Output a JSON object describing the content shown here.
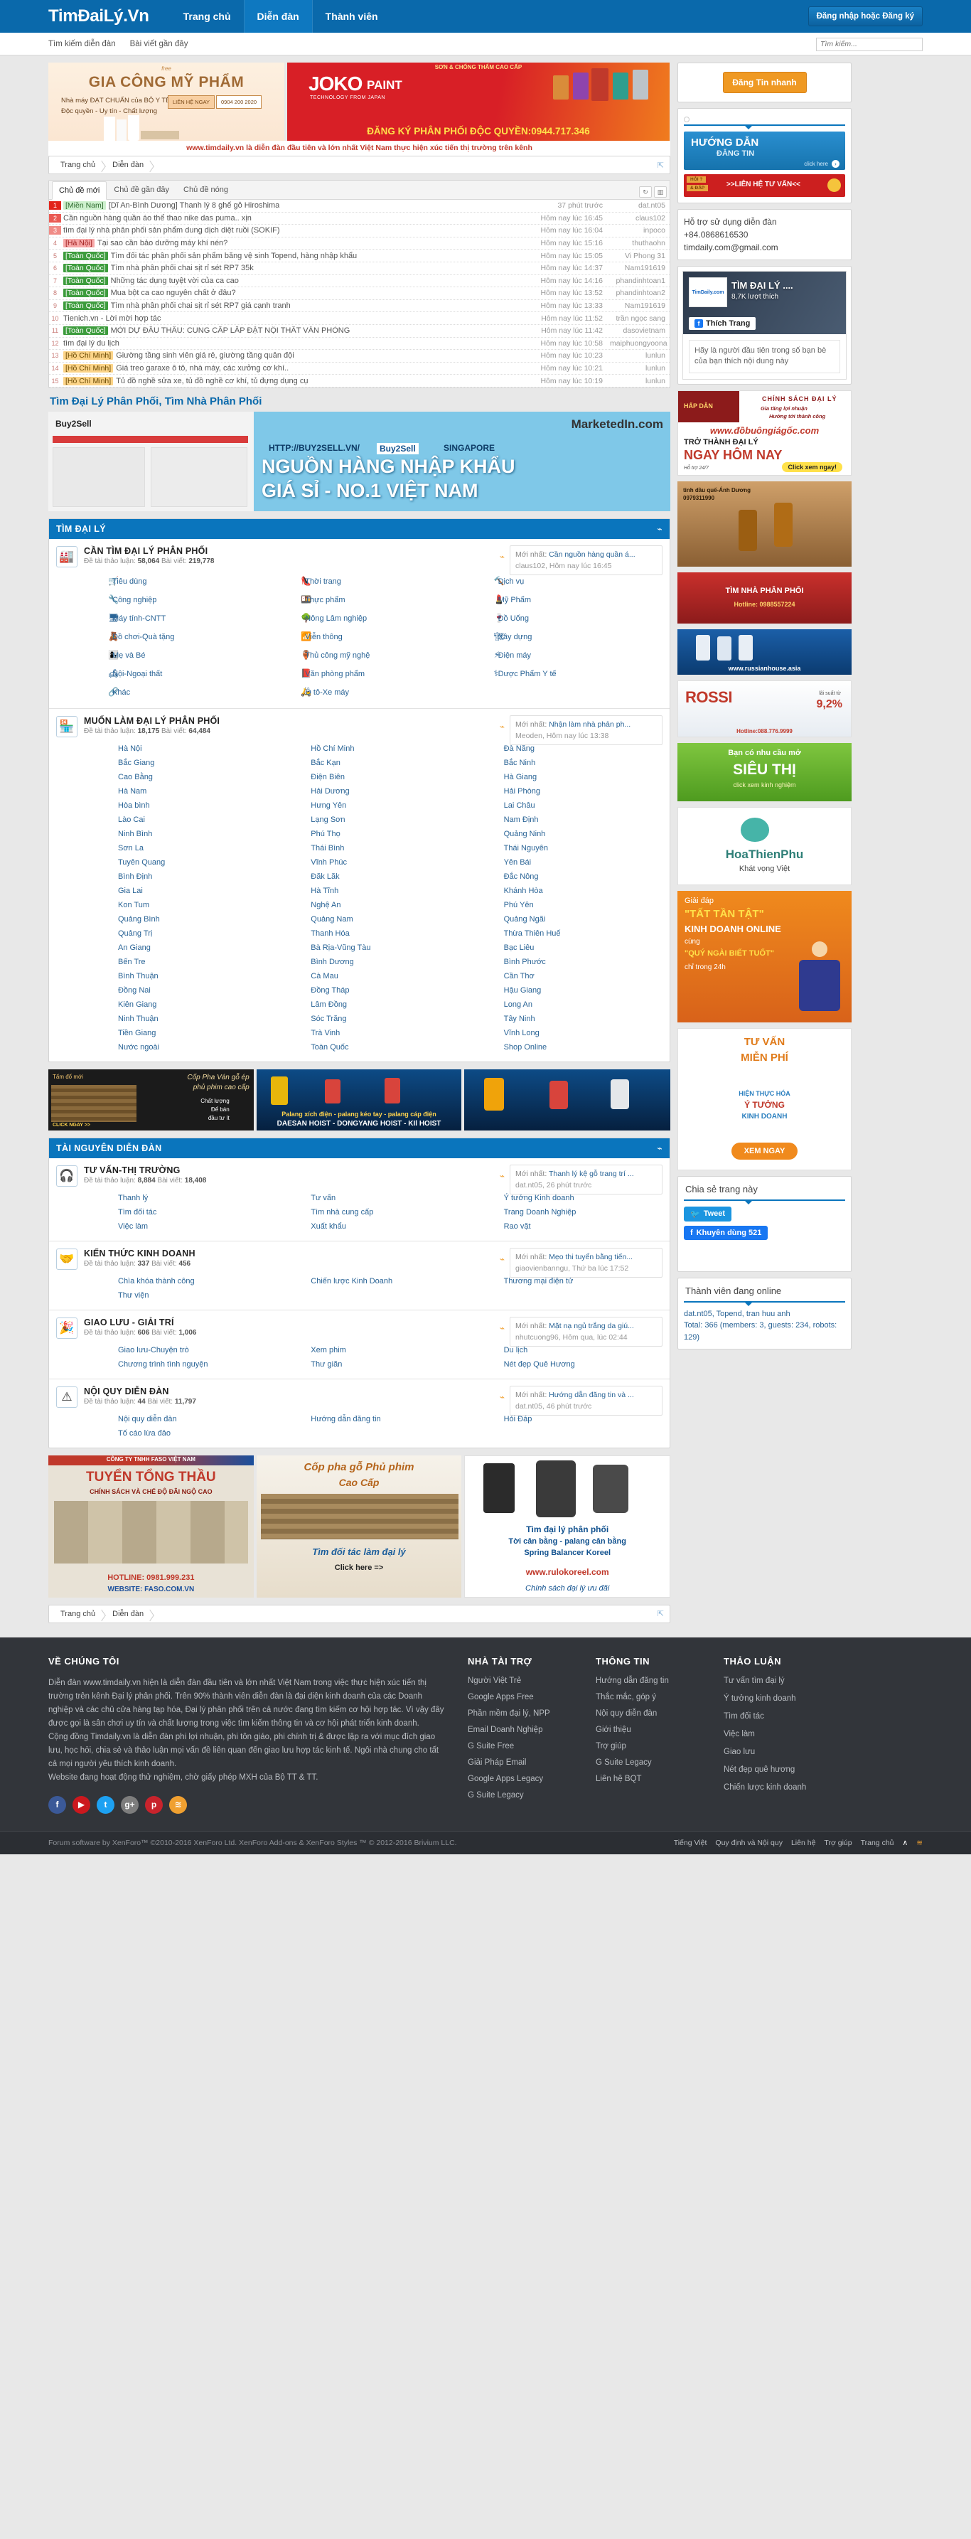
{
  "header": {
    "logo": "TimĐaiLý.Vn",
    "nav": [
      {
        "label": "Trang chủ",
        "selected": false
      },
      {
        "label": "Diễn đàn",
        "selected": true
      },
      {
        "label": "Thành viên",
        "selected": false
      }
    ],
    "login_label": "Đăng nhập hoặc Đăng ký",
    "subnav": [
      "Tìm kiếm diễn đàn",
      "Bài viết gần đây"
    ],
    "search_placeholder": "Tìm kiếm...",
    "search_value": ""
  },
  "ads": {
    "banner_left": {
      "line1": "free",
      "title": "GIA CÔNG MỸ PHẨM",
      "sub1": "Nhà máy ĐẠT CHUẨN của BỘ Y TẾ",
      "sub2": "Độc quyền - Uy tín - Chất lượng",
      "btn": "LIÊN HỆ NGAY",
      "phone": "0904 200 2020"
    },
    "banner_right": {
      "top": "SƠN & CHỐNG THẤM CAO CẤP",
      "brand": "JOKO",
      "brand2": "PAINT",
      "tech": "TECHNOLOGY FROM JAPAN",
      "bottom": "ĐĂNG KÝ PHÂN PHỐI ĐỘC QUYỀN:0944.717.346"
    },
    "tagline": "www.timdaily.vn là diễn đàn đầu tiên và lớn nhất Việt Nam thực hiện xúc tiến thị trường trên kênh",
    "mid_banner": {
      "url": "HTTP://BUY2SELL.VN/",
      "brand": "Buy2Sell",
      "city": "SINGAPORE",
      "l1": "NGUỒN HÀNG NHẬP KHẨU",
      "l2": "GIÁ SỈ - NO.1 VIỆT NAM",
      "left_logo": "Buy2Sell",
      "right_logo": "MarketedIn.com"
    },
    "hoist": {
      "l1": "Tấm đổ mới",
      "l2": "Cốp Pha Ván gỗ ép",
      "l3": "phủ phim cao cấp",
      "l4": "Chất lượng",
      "l5": "Để bán",
      "l6": "đầu tư ít",
      "click": "CLICK NGAY >>",
      "mid1": "Palang xích điện - palang kéo tay - palang cáp điện",
      "mid2": "DAESAN HOIST - DONGYANG HOIST - KIl HOIST"
    },
    "faso": {
      "co": "CÔNG TY TNHH FASO VIỆT NAM",
      "t1": "TUYỂN TỔNG THẦU",
      "t2": "CHÍNH SÁCH VÀ CHẾ ĐỘ ĐÃI NGỘ CAO",
      "hot": "HOTLINE: 0981.999.231",
      "web": "WEBSITE: FASO.COM.VN"
    },
    "copha": {
      "t1": "Cốp pha gỗ Phủ phim",
      "t2": "Cao Cấp",
      "t3": "Tìm đối tác làm đại lý",
      "t4": "Click here =>"
    },
    "koreel": {
      "t1": "Tìm đại lý phân phối",
      "t2": "Tời cân bằng - palang cân bằng",
      "t3": "Spring Balancer Koreel",
      "t4": "www.rulokoreel.com",
      "t5": "Chính sách đại lý ưu đãi"
    }
  },
  "breadcrumb": [
    "Trang chủ",
    "Diễn đàn"
  ],
  "ticker": {
    "tabs": [
      {
        "label": "Chủ đề mới",
        "active": true
      },
      {
        "label": "Chủ đề gần đây",
        "active": false
      },
      {
        "label": "Chủ đề nóng",
        "active": false
      }
    ],
    "tool_refresh": "↻",
    "tool_layout": "▥",
    "rows": [
      {
        "n": "1",
        "heat": "h1",
        "loc": "[Miền Nam]",
        "loc_style": "green",
        "title": "[Dĩ An-Bình Dương] Thanh lý 8 ghế gỗ Hiroshima",
        "time": "37 phút trước",
        "user": "dat.nt05"
      },
      {
        "n": "2",
        "heat": "h2",
        "loc": "",
        "loc_style": "",
        "title": "Cần nguồn hàng quần áo thể thao nike das puma.. xịn",
        "time": "Hôm nay lúc 16:45",
        "user": "claus102"
      },
      {
        "n": "3",
        "heat": "h3",
        "loc": "",
        "loc_style": "",
        "title": "tìm đại lý nhà phân phối sản phẩm dung dịch diệt ruồi (SOKIF)",
        "time": "Hôm nay lúc 16:04",
        "user": "inpoco"
      },
      {
        "n": "4",
        "heat": "plain",
        "loc": "[Hà Nội]",
        "loc_style": "red",
        "title": "Tại sao cần bảo dưỡng máy khí nén?",
        "time": "Hôm nay lúc 15:16",
        "user": "thuthaohn"
      },
      {
        "n": "5",
        "heat": "plain",
        "loc": "[Toàn Quốc]",
        "loc_style": "greend",
        "title": "Tìm đối tác phân phối sản phẩm băng vệ sinh Topend, hàng nhập khẩu",
        "time": "Hôm nay lúc 15:05",
        "user": "Vi Phong 31"
      },
      {
        "n": "6",
        "heat": "plain",
        "loc": "[Toàn Quốc]",
        "loc_style": "greend",
        "title": "Tìm nhà phân phối chai sịt rỉ sét RP7 35k",
        "time": "Hôm nay lúc 14:37",
        "user": "Nam191619"
      },
      {
        "n": "7",
        "heat": "plain",
        "loc": "[Toàn Quốc]",
        "loc_style": "greend",
        "title": "Những tác dụng tuyệt vời của ca cao",
        "time": "Hôm nay lúc 14:16",
        "user": "phandinhtoan1"
      },
      {
        "n": "8",
        "heat": "plain",
        "loc": "[Toàn Quốc]",
        "loc_style": "greend",
        "title": "Mua bột ca cao nguyên chất ở đâu?",
        "time": "Hôm nay lúc 13:52",
        "user": "phandinhtoan2"
      },
      {
        "n": "9",
        "heat": "plain",
        "loc": "[Toàn Quốc]",
        "loc_style": "greend",
        "title": "Tìm nhà phân phối chai sịt rỉ sét RP7 giá cạnh tranh",
        "time": "Hôm nay lúc 13:33",
        "user": "Nam191619"
      },
      {
        "n": "10",
        "heat": "plain",
        "loc": "",
        "loc_style": "",
        "title": "Tienich.vn - Lời mời hợp tác",
        "time": "Hôm nay lúc 11:52",
        "user": "trần ngọc sang"
      },
      {
        "n": "11",
        "heat": "plain",
        "loc": "[Toàn Quốc]",
        "loc_style": "greend",
        "title": "MỜI DỰ ĐẤU THẦU: CUNG CẤP LẮP ĐẶT NỘI THẤT VĂN PHÒNG",
        "time": "Hôm nay lúc 11:42",
        "user": "dasovietnam"
      },
      {
        "n": "12",
        "heat": "plain",
        "loc": "",
        "loc_style": "",
        "title": "tìm đại lý du lịch",
        "time": "Hôm nay lúc 10:58",
        "user": "maiphuongyoona"
      },
      {
        "n": "13",
        "heat": "plain",
        "loc": "[Hồ Chí Minh]",
        "loc_style": "orange",
        "title": "Giường tầng sinh viên giá rẻ, giường tầng quân đội",
        "time": "Hôm nay lúc 10:23",
        "user": "lunlun"
      },
      {
        "n": "14",
        "heat": "plain",
        "loc": "[Hồ Chí Minh]",
        "loc_style": "orange",
        "title": "Giá treo garaxe ô tô, nhà máy, các xưởng cơ khí..",
        "time": "Hôm nay lúc 10:21",
        "user": "lunlun"
      },
      {
        "n": "15",
        "heat": "plain",
        "loc": "[Hồ Chí Minh]",
        "loc_style": "orange",
        "title": "Tủ đồ nghề sửa xe, tủ đồ nghề cơ khí, tủ đựng dụng cụ",
        "time": "Hôm nay lúc 10:19",
        "user": "lunlun"
      }
    ]
  },
  "section_heading": "Tìm Đại Lý Phân Phối, Tìm Nhà Phân Phối",
  "forum_a": {
    "title": "TÌM ĐẠI LÝ",
    "nodes": [
      {
        "icon": "🏭",
        "name": "CẦN TÌM ĐẠI LÝ PHÂN PHỐI",
        "stats_label1": "Đề tài thảo luận:",
        "stats_v1": "58,064",
        "stats_label2": "Bài viết:",
        "stats_v2": "219,778",
        "latest_prefix": "Mới nhất:",
        "latest_title": "Cần nguồn hàng quần á...",
        "latest_meta": "claus102, Hôm nay lúc 16:45",
        "cols": [
          [
            {
              "ic": "🛒",
              "t": "Tiêu dùng"
            },
            {
              "ic": "🔧",
              "t": "Công nghiệp"
            },
            {
              "ic": "🖥",
              "t": "Máy tính-CNTT"
            },
            {
              "ic": "🧸",
              "t": "Đồ chơi-Quà tặng"
            },
            {
              "ic": "👩‍👦",
              "t": "Mẹ và Bé"
            },
            {
              "ic": "🛋",
              "t": "Nội-Ngoại thất"
            },
            {
              "ic": "🔗",
              "t": "Khác"
            }
          ],
          [
            {
              "ic": "👠",
              "t": "Thời trang"
            },
            {
              "ic": "🍱",
              "t": "Thực phẩm"
            },
            {
              "ic": "🌳",
              "t": "Nông Lâm nghiệp"
            },
            {
              "ic": "📶",
              "t": "Viễn thông"
            },
            {
              "ic": "🏺",
              "t": "Thủ công mỹ nghệ"
            },
            {
              "ic": "📕",
              "t": "Văn phòng phẩm"
            },
            {
              "ic": "🛵",
              "t": "Ô tô-Xe máy"
            }
          ],
          [
            {
              "ic": "🔨",
              "t": "Dịch vụ"
            },
            {
              "ic": "💄",
              "t": "Mỹ Phẩm"
            },
            {
              "ic": "🍷",
              "t": "Đồ Uống"
            },
            {
              "ic": "🏗",
              "t": "Xây dựng"
            },
            {
              "ic": "⚡",
              "t": "Điện máy"
            },
            {
              "ic": "⚕",
              "t": "Dược Phẩm Y tế"
            }
          ]
        ]
      },
      {
        "icon": "🏪",
        "name": "MUỐN LÀM ĐẠI LÝ PHÂN PHỐI",
        "stats_label1": "Đề tài thảo luận:",
        "stats_v1": "18,175",
        "stats_label2": "Bài viết:",
        "stats_v2": "64,484",
        "latest_prefix": "Mới nhất:",
        "latest_title": "Nhận làm nhà phân ph...",
        "latest_meta": "Meoden, Hôm nay lúc 13:38",
        "plain_cols": [
          [
            "Hà Nội",
            "Bắc Giang",
            "Cao Bằng",
            "Hà Nam",
            "Hòa bình",
            "Lào Cai",
            "Ninh Bình",
            "Sơn La",
            "Tuyên Quang",
            "Bình Định",
            "Gia Lai",
            "Kon Tum",
            "Quảng Bình",
            "Quảng Trị",
            "An Giang",
            "Bến Tre",
            "Bình Thuận",
            "Đồng Nai",
            "Kiên Giang",
            "Ninh Thuận",
            "Tiền Giang",
            "Nước ngoài"
          ],
          [
            "Hồ Chí Minh",
            "Bắc Kạn",
            "Điện Biên",
            "Hải Dương",
            "Hưng Yên",
            "Lạng Sơn",
            "Phú Thọ",
            "Thái Bình",
            "Vĩnh Phúc",
            "Đăk Lăk",
            "Hà Tĩnh",
            "Nghệ An",
            "Quảng Nam",
            "Thanh Hóa",
            "Bà Rịa-Vũng Tàu",
            "Bình Dương",
            "Cà Mau",
            "Đồng Tháp",
            "Lâm Đồng",
            "Sóc Trăng",
            "Trà Vinh",
            "Toàn Quốc"
          ],
          [
            "Đà Nẵng",
            "Bắc Ninh",
            "Hà Giang",
            "Hải Phòng",
            "Lai Châu",
            "Nam Định",
            "Quảng Ninh",
            "Thái Nguyên",
            "Yên Bái",
            "Đắc Nông",
            "Khánh Hòa",
            "Phú Yên",
            "Quảng Ngãi",
            "Thừa Thiên Huế",
            "Bạc Liêu",
            "Bình Phước",
            "Cần Thơ",
            "Hậu Giang",
            "Long An",
            "Tây Ninh",
            "Vĩnh Long",
            "Shop Online"
          ]
        ]
      }
    ]
  },
  "forum_b": {
    "title": "TÀI NGUYÊN DIỄN ĐÀN",
    "nodes": [
      {
        "icon": "🎧",
        "name": "TƯ VẤN-THỊ TRƯỜNG",
        "stats_label1": "Đề tài thảo luận:",
        "stats_v1": "8,884",
        "stats_label2": "Bài viết:",
        "stats_v2": "18,408",
        "latest_prefix": "Mới nhất:",
        "latest_title": "Thanh lý kệ gỗ trang trí ...",
        "latest_meta": "dat.nt05, 26 phút trước",
        "plain_cols": [
          [
            "Thanh lý",
            "Tìm đối tác",
            "Việc làm"
          ],
          [
            "Tư vấn",
            "Tìm nhà cung cấp",
            "Xuất khẩu"
          ],
          [
            "Ý tưởng Kinh doanh",
            "Trang Doanh Nghiệp",
            "Rao vặt"
          ]
        ]
      },
      {
        "icon": "🤝",
        "name": "KIẾN THỨC KINH DOANH",
        "stats_label1": "Đề tài thảo luận:",
        "stats_v1": "337",
        "stats_label2": "Bài viết:",
        "stats_v2": "456",
        "latest_prefix": "Mới nhất:",
        "latest_title": "Mẹo thi tuyển bằng tiến...",
        "latest_meta": "giaovienbanngu, Thứ ba lúc 17:52",
        "plain_cols": [
          [
            "Chìa khóa thành công",
            "Thư viện"
          ],
          [
            "Chiến lược Kinh Doanh"
          ],
          [
            "Thương mại điện tử"
          ]
        ]
      },
      {
        "icon": "🎉",
        "name": "GIAO LƯU - GIẢI TRÍ",
        "stats_label1": "Đề tài thảo luận:",
        "stats_v1": "606",
        "stats_label2": "Bài viết:",
        "stats_v2": "1,006",
        "latest_prefix": "Mới nhất:",
        "latest_title": "Mặt nạ ngủ trắng da giú...",
        "latest_meta": "nhutcuong96, Hôm qua, lúc 02:44",
        "plain_cols": [
          [
            "Giao lưu-Chuyện trò",
            "Chương trình tình nguyện"
          ],
          [
            "Xem phim",
            "Thư giãn"
          ],
          [
            "Du lịch",
            "Nét đẹp Quê Hương"
          ]
        ]
      },
      {
        "icon": "⚠",
        "name": "NỘI QUY DIỄN ĐÀN",
        "stats_label1": "Đề tài thảo luận:",
        "stats_v1": "44",
        "stats_label2": "Bài viết:",
        "stats_v2": "11,797",
        "latest_prefix": "Mới nhất:",
        "latest_title": "Hướng dẫn đăng tin và ...",
        "latest_meta": "dat.nt05, 46 phút trước",
        "plain_cols": [
          [
            "Nội quy diễn đàn",
            "Tố cáo lừa đảo"
          ],
          [
            "Hướng dẫn đăng tin"
          ],
          [
            "Hỏi Đáp"
          ]
        ]
      }
    ]
  },
  "sidebar": {
    "post_button": "Đăng Tin nhanh",
    "guide_banner": {
      "l1": "HƯỚNG DẪN",
      "l2": "ĐĂNG TIN",
      "l3": "click here"
    },
    "contact_banner": {
      "l1": "HỎI ?",
      "l2": "& ĐÁP",
      "l3": ">>LIÊN HỆ TƯ VẤN<<"
    },
    "support": {
      "l1": "Hỗ trợ sử dụng diễn đàn",
      "l2": "+84.0868616530",
      "l3": "timdaily.com@gmail.com"
    },
    "facebook": {
      "logo_text": "TimDaily.com",
      "page": "TÌM ĐẠI LÝ ....",
      "likes": "8,7K lượt thích",
      "like_btn": "Thích Trang",
      "note": "Hãy là người đầu tiên trong số bạn bè của bạn thích nội dung này"
    },
    "ad_dobuon": {
      "tag": "HẤP DẪN",
      "policy": "CHÍNH SÁCH ĐẠI LÝ",
      "p1": "Gia tăng lợi nhuận",
      "p2": "Hướng tới thành công",
      "url": "www.đồbuôngiágốc.com",
      "t1": "TRỞ THÀNH ĐẠI LÝ",
      "t2": "NGAY HÔM NAY",
      "t3": "Hỗ trợ 24/7",
      "cta": "Click xem ngay!"
    },
    "ad_tinhdau": {
      "l1": "tinh dầu quế-Ánh Dương",
      "l2": "0979311990"
    },
    "ad_nhapkhau": {
      "l1": "TÌM NHÀ PHÂN PHỐI",
      "l2": "Hotline: 0988557224"
    },
    "ad_russian": {
      "l1": "www.russianhouse.asia"
    },
    "ad_rossi": {
      "brand": "ROSSI",
      "pct": "9,2%",
      "l1": "lãi suất từ",
      "hot": "Hotline:088.776.9999"
    },
    "ad_sieuthi": {
      "l1": "Bạn có nhu cầu mở",
      "l2": "SIÊU THỊ",
      "l3": "click xem kinh nghiệm"
    },
    "ad_hoathienphu": {
      "l1": "HoaThienPhu",
      "l2": "Khát vọng Việt"
    },
    "ad_tattantat": {
      "l1": "Giải đáp",
      "l2": "\"TẤT TẦN TẬT\"",
      "l3": "KINH DOANH ONLINE",
      "l4": "cùng",
      "l5": "\"QUÝ NGÀI BIẾT TUỐT\"",
      "l6": "chỉ trong 24h"
    },
    "ad_tuvan": {
      "l1": "TƯ VẤN",
      "l2": "MIỄN PHÍ",
      "l3": "HIỆN THỰC HÓA",
      "l4": "Ý TƯỞNG",
      "l5": "KINH DOANH",
      "cta": "XEM NGAY"
    },
    "share": {
      "title": "Chia sẻ trang này",
      "tweet": "Tweet",
      "fb": "Khuyên dùng 521"
    },
    "online": {
      "title": "Thành viên đang online",
      "users": "dat.nt05, Topend, tran huu anh",
      "total": "Total: 366 (members: 3, guests: 234, robots: 129)"
    }
  },
  "footer": {
    "about_title": "VỀ CHÚNG TÔI",
    "about_p1": "Diễn đàn www.timdaily.vn hiện là diễn đàn đầu tiên và lớn nhất Việt Nam trong việc thực hiện xúc tiến thị trường trên kênh Đại lý phân phối. Trên 90% thành viên diễn đàn là đại diện kinh doanh của các Doanh nghiệp và các chủ cửa hàng tạp hóa, Đại lý phân phối trên cả nước đang tìm kiếm cơ hội hợp tác. Vì vậy đây được gọi là sân chơi uy tín và chất lượng trong việc tìm kiếm thông tin và cơ hội phát triển kinh doanh.",
    "about_p2": "Cộng đồng Timdaily.vn là diễn đàn phi lợi nhuận, phi tôn giáo, phi chính trị & được lập ra với mục đích giao lưu, học hỏi, chia sẻ và thảo luận mọi vấn đề liên quan đến giao lưu hợp tác kinh tế. Ngôi nhà chung cho tất cả mọi người yêu thích kinh doanh.",
    "about_p3": "Website đang hoạt động thử nghiệm, chờ giấy phép MXH của Bộ TT & TT.",
    "socials": [
      {
        "name": "facebook-icon",
        "glyph": "f",
        "color": "#3b5998"
      },
      {
        "name": "youtube-icon",
        "glyph": "▶",
        "color": "#cc181e"
      },
      {
        "name": "twitter-icon",
        "glyph": "t",
        "color": "#1da1f2"
      },
      {
        "name": "google-plus-icon",
        "glyph": "g+",
        "color": "#7d7d7d"
      },
      {
        "name": "pinterest-icon",
        "glyph": "p",
        "color": "#c8232c"
      },
      {
        "name": "rss-icon",
        "glyph": "≋",
        "color": "#f0a030"
      }
    ],
    "cols": [
      {
        "title": "NHÀ TÀI TRỢ",
        "items": [
          "Người Việt Trẻ",
          "Google Apps Free",
          "Phần mềm đại lý, NPP",
          "Email Doanh Nghiệp",
          "G Suite Free",
          "Giải Pháp Email",
          "Google Apps Legacy",
          "G Suite Legacy"
        ]
      },
      {
        "title": "THÔNG TIN",
        "items": [
          "Hướng dẫn đăng tin",
          "Thắc mắc, góp ý",
          "Nội quy diễn đàn",
          "Giới thiệu",
          "Trợ giúp",
          "G Suite Legacy",
          "Liên hệ BQT"
        ]
      },
      {
        "title": "THẢO LUẬN",
        "items": [
          "Tư vấn tìm đại lý",
          "Ý tưởng kinh doanh",
          "Tìm đối tác",
          "Việc làm",
          "Giao lưu",
          "Nét đẹp quê hương",
          "Chiến lược kinh doanh"
        ]
      }
    ],
    "license": "Forum software by XenForo™ ©2010-2016 XenForo Ltd. XenForo Add-ons & XenForo Styles ™ © 2012-2016 Brivium LLC.",
    "bot_links": [
      "Tiếng Việt",
      "Quy định và Nội quy",
      "Liên hệ",
      "Trợ giúp",
      "Trang chủ"
    ],
    "bot_up": "∧",
    "bot_rss": "≋"
  }
}
